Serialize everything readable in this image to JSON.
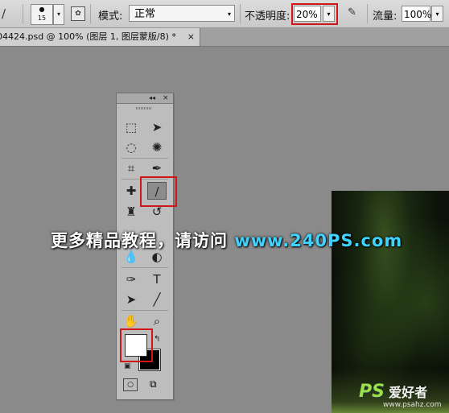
{
  "options_bar": {
    "brush_size": "15",
    "mode_label": "模式:",
    "mode_value": "正常",
    "opacity_label": "不透明度:",
    "opacity_value": "20%",
    "flow_label": "流量:",
    "flow_value": "100%"
  },
  "document_tab": {
    "title": "04424.psd @ 100% (图层 1, 图层蒙版/8) *",
    "close": "×"
  },
  "toolbox": {
    "collapse": "◂◂",
    "close": "×",
    "type_tool": "T"
  },
  "watermark": {
    "text": "更多精品教程，请访问",
    "url": "www.240PS.com"
  },
  "logo": {
    "mark": "PS",
    "cn": "爱好者",
    "url": "www.psahz.com"
  },
  "colors": {
    "foreground": "#ffffff",
    "background": "#000000",
    "highlight": "#d21515"
  }
}
